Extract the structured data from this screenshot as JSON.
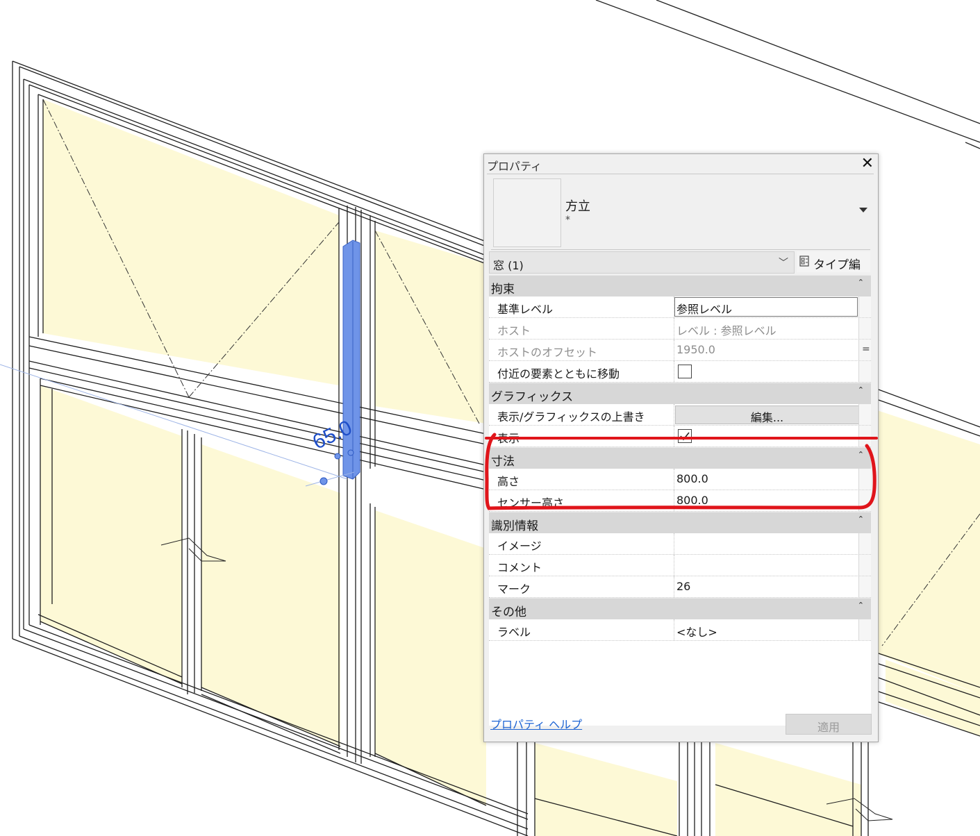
{
  "viewport": {
    "dimension_value": "65.0"
  },
  "properties_panel": {
    "title": "プロパティ",
    "close_symbol": "✕",
    "type_name": "方立",
    "type_sub": "*",
    "filter_value": "窓 (1)",
    "type_edit_label": "タイプ編集",
    "categories": {
      "constraints": "拘束",
      "graphics": "グラフィックス",
      "dimensions": "寸法",
      "identity": "識別情報",
      "other": "その他"
    },
    "rows": {
      "base_level": {
        "name": "基準レベル",
        "value": "参照レベル"
      },
      "host": {
        "name": "ホスト",
        "value": "レベル : 参照レベル"
      },
      "host_offset": {
        "name": "ホストのオフセット",
        "value": "1950.0"
      },
      "move_with_nearby": {
        "name": "付近の要素とともに移動"
      },
      "vg_overrides": {
        "name": "表示/グラフィックスの上書き",
        "button": "編集..."
      },
      "visible": {
        "name": "表示"
      },
      "height": {
        "name": "高さ",
        "value": "800.0"
      },
      "sensor_height": {
        "name": "センサー高さ",
        "value": "800.0"
      },
      "image": {
        "name": "イメージ",
        "value": ""
      },
      "comment": {
        "name": "コメント",
        "value": ""
      },
      "mark": {
        "name": "マーク",
        "value": "26"
      },
      "label": {
        "name": "ラベル",
        "value": "<なし>"
      }
    },
    "help_link": "プロパティ ヘルプ",
    "apply_label": "適用"
  },
  "colors": {
    "glass": "#fdf9d6",
    "selected_mullion": "#6f94e8",
    "annotation_red": "#e0151b",
    "dimension_blue": "#1f4fc8"
  }
}
